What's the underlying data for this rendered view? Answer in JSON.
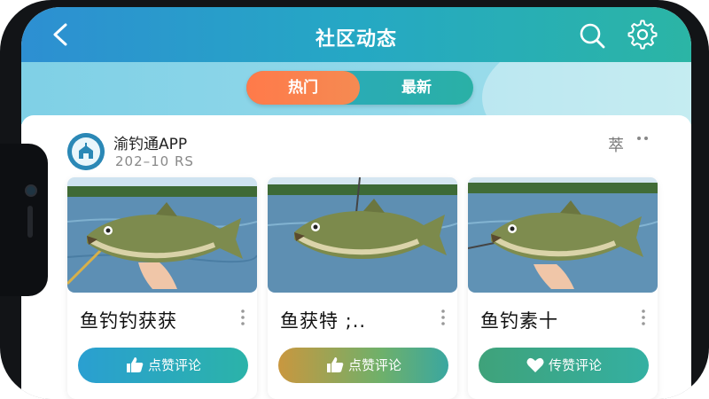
{
  "header": {
    "title": "社区动态",
    "back_icon": "chevron-left-icon",
    "search_icon": "search-icon",
    "settings_icon": "gear-icon"
  },
  "tabs": [
    {
      "label": "热门",
      "active": true
    },
    {
      "label": "最新",
      "active": false
    }
  ],
  "post": {
    "author": "渝钓通APP",
    "meta": "202–10 RS",
    "more_label": "萃",
    "cards": [
      {
        "title": "鱼钓钓获获",
        "action_label": "点赞评论",
        "action_icon": "thumbs-up-icon",
        "action_color": "#2a9fd1"
      },
      {
        "title": "鱼获特 ;..",
        "action_label": "点赞评论",
        "action_icon": "thumbs-up-icon",
        "action_color": "#6fa64a"
      },
      {
        "title": "鱼钓素十",
        "action_label": "传赞评论",
        "action_icon": "heart-icon",
        "action_color": "#3fa27a"
      }
    ]
  },
  "colors": {
    "header_start": "#2d8fd2",
    "header_end": "#2bb5a5",
    "tab_active": "#ff7a4a",
    "tab_inactive": "#2aa7c2"
  }
}
